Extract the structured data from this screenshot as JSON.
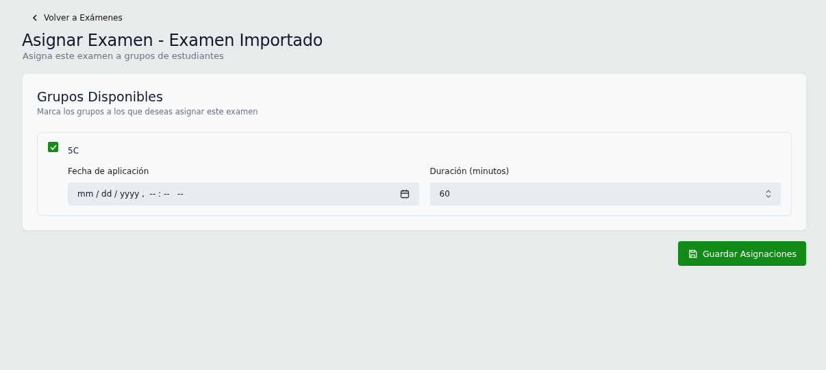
{
  "back_link": "Volver a Exámenes",
  "title": "Asignar Examen - Examen Importado",
  "subtitle": "Asigna este examen a grupos de estudiantes",
  "card": {
    "title": "Grupos Disponibles",
    "description": "Marca los grupos a los que deseas asignar este examen",
    "groups": [
      {
        "name": "5C",
        "checked": true,
        "date_label": "Fecha de aplicación",
        "date_value": "mm / dd / yyyy ,  -- : --   --",
        "duration_label": "Duración (minutos)",
        "duration_value": "60"
      }
    ]
  },
  "save_button": "Guardar Asignaciones"
}
